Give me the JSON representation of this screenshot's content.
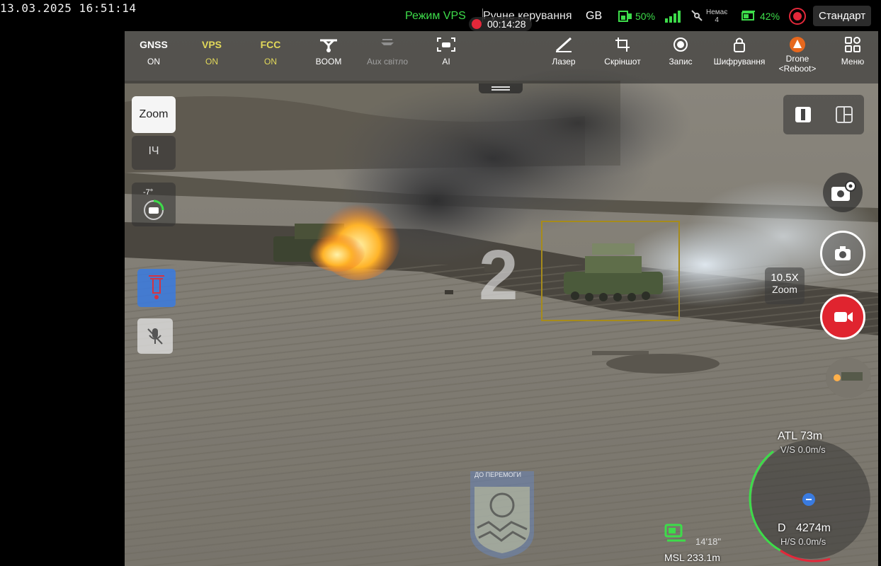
{
  "timestamp": "13.03.2025 16:51:14",
  "status_bar": {
    "mode": "Режим VPS",
    "control": "Ручне керування",
    "unit": "GB",
    "rc_battery": "50%",
    "satellite_status": "Немає",
    "satellite_count": "4",
    "drone_battery": "42%",
    "preset": "Стандарт"
  },
  "recording_timer": "00:14:28",
  "toolbar": {
    "gnss": {
      "label": "GNSS",
      "state": "ON"
    },
    "vps": {
      "label": "VPS",
      "state": "ON"
    },
    "fcc": {
      "label": "FCC",
      "state": "ON"
    },
    "boom": "BOOM",
    "aux_light": "Aux світло",
    "ai": "AI",
    "laser": "Лазер",
    "screenshot": "Скріншот",
    "record": "Запис",
    "encryption": "Шифрування",
    "drone_reboot_line1": "Drone",
    "drone_reboot_line2": "<Reboot>",
    "menu": "Меню"
  },
  "left_controls": {
    "zoom_label": "Zoom",
    "lens_label": "IЧ",
    "gimbal_angle": "-7°"
  },
  "zoom_readout": {
    "value": "10.5X",
    "label": "Zoom"
  },
  "overlay_number": "2",
  "telemetry": {
    "atl": "ATL 73m",
    "vs": "V/S 0.0m/s",
    "distance_label": "D",
    "distance": "4274m",
    "hs": "H/S 0.0m/s",
    "msl": "MSL 233.1m",
    "flight_time": "14'18\""
  },
  "emblem_text": "ДО ПЕРЕМОГИ"
}
